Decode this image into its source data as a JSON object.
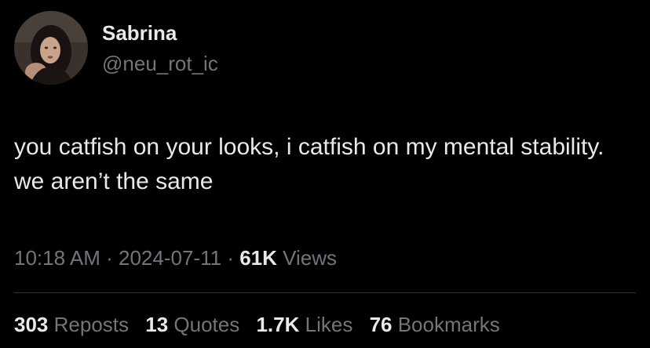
{
  "author": {
    "display_name": "Sabrina",
    "handle": "@neu_rot_ic"
  },
  "tweet": {
    "text": "you catfish on your looks, i catfish on my mental stability. we aren’t the same"
  },
  "meta": {
    "time": "10:18 AM",
    "separator": "·",
    "date": "2024-07-11",
    "views_count": "61K",
    "views_label": "Views"
  },
  "stats": [
    {
      "count": "303",
      "label": "Reposts"
    },
    {
      "count": "13",
      "label": "Quotes"
    },
    {
      "count": "1.7K",
      "label": "Likes"
    },
    {
      "count": "76",
      "label": "Bookmarks"
    }
  ],
  "colors": {
    "background": "#000000",
    "primary_text": "#e7e9ea",
    "secondary_text": "#71767b",
    "divider": "#2f3336"
  },
  "icons": {
    "avatar": "profile-photo"
  }
}
